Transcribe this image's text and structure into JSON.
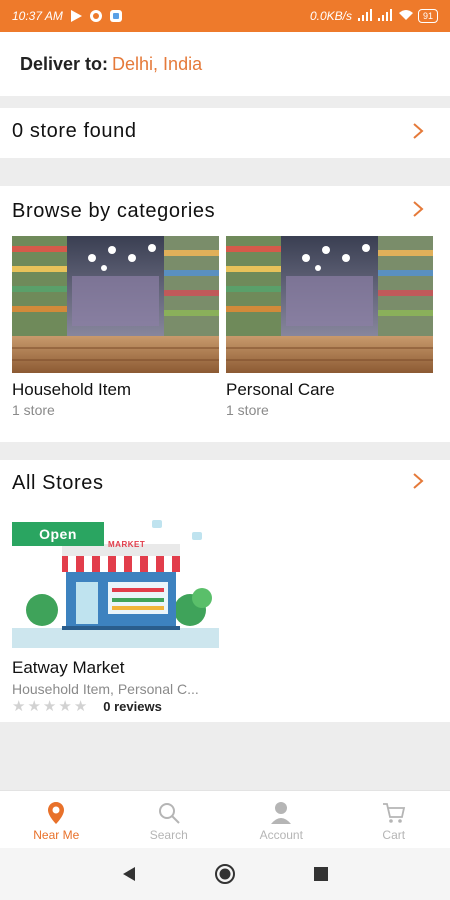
{
  "status_bar": {
    "time": "10:37 AM",
    "net_speed": "0.0KB/s",
    "battery": "91"
  },
  "header": {
    "deliver_label": "Deliver to:",
    "location": "Delhi, India"
  },
  "stores_found": {
    "text": "0 store found"
  },
  "categories": {
    "title": "Browse by categories",
    "items": [
      {
        "name": "Household Item",
        "count": "1 store"
      },
      {
        "name": "Personal Care",
        "count": "1 store"
      }
    ]
  },
  "all_stores": {
    "title": "All Stores",
    "items": [
      {
        "status": "Open",
        "sign": "MARKET",
        "name": "Eatway Market",
        "categories": "Household Item, Personal C...",
        "rating": 0,
        "reviews": "0 reviews"
      }
    ]
  },
  "bottom_nav": {
    "items": [
      {
        "label": "Near Me",
        "icon": "location-pin-icon",
        "active": true
      },
      {
        "label": "Search",
        "icon": "search-icon",
        "active": false
      },
      {
        "label": "Account",
        "icon": "account-icon",
        "active": false
      },
      {
        "label": "Cart",
        "icon": "cart-icon",
        "active": false
      }
    ]
  },
  "colors": {
    "accent": "#ee7a2b",
    "open_badge": "#2aa561",
    "inactive": "#b5b5b5"
  }
}
